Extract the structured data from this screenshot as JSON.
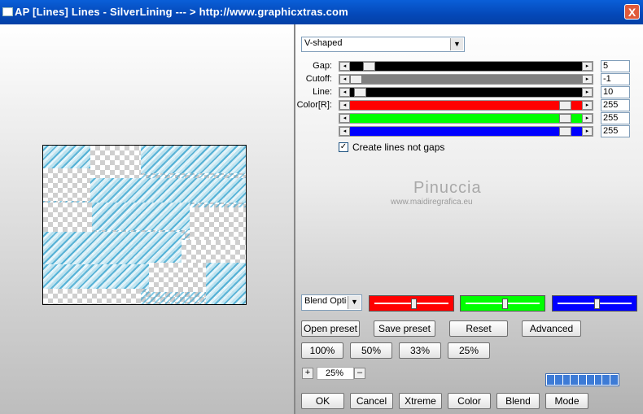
{
  "window": {
    "title": "AP [Lines]  Lines - SilverLining       --- > http://www.graphicxtras.com",
    "close_glyph": "X"
  },
  "mode_select": {
    "value": "V-shaped"
  },
  "sliders": [
    {
      "label": "Gap:",
      "value": "5",
      "fraction": 0.06,
      "fill": "#000000"
    },
    {
      "label": "Cutoff:",
      "value": "-1",
      "fraction": 0.0,
      "fill": "#808080"
    },
    {
      "label": "Line:",
      "value": "10",
      "fraction": 0.02,
      "fill": "#000000"
    },
    {
      "label": "Color[R]:",
      "value": "255",
      "fraction": 0.95,
      "fill": "#ff0000"
    },
    {
      "label": "",
      "value": "255",
      "fraction": 0.95,
      "fill": "#00ff00"
    },
    {
      "label": "",
      "value": "255",
      "fraction": 0.95,
      "fill": "#0000ff"
    }
  ],
  "checkbox": {
    "label": "Create lines not gaps",
    "checked": true,
    "mark": "✓"
  },
  "watermark": {
    "line1": "Pinuccia",
    "line2": "www.maidiregrafica.eu"
  },
  "blend_select": {
    "value": "Blend Optio"
  },
  "color_boxes": [
    {
      "color": "#ff0000",
      "fraction": 0.5
    },
    {
      "color": "#00ff00",
      "fraction": 0.5
    },
    {
      "color": "#0000ff",
      "fraction": 0.5
    }
  ],
  "buttons_row1": [
    "Open preset",
    "Save preset",
    "Reset",
    "Advanced"
  ],
  "buttons_row2": [
    "100%",
    "50%",
    "33%",
    "25%"
  ],
  "zoom": {
    "plus": "+",
    "value": "25%",
    "minus": "–"
  },
  "progress": {
    "segments": 9,
    "filled": 9
  },
  "buttons_bottom": [
    "OK",
    "Cancel",
    "Xtreme",
    "Color",
    "Blend",
    "Mode"
  ]
}
